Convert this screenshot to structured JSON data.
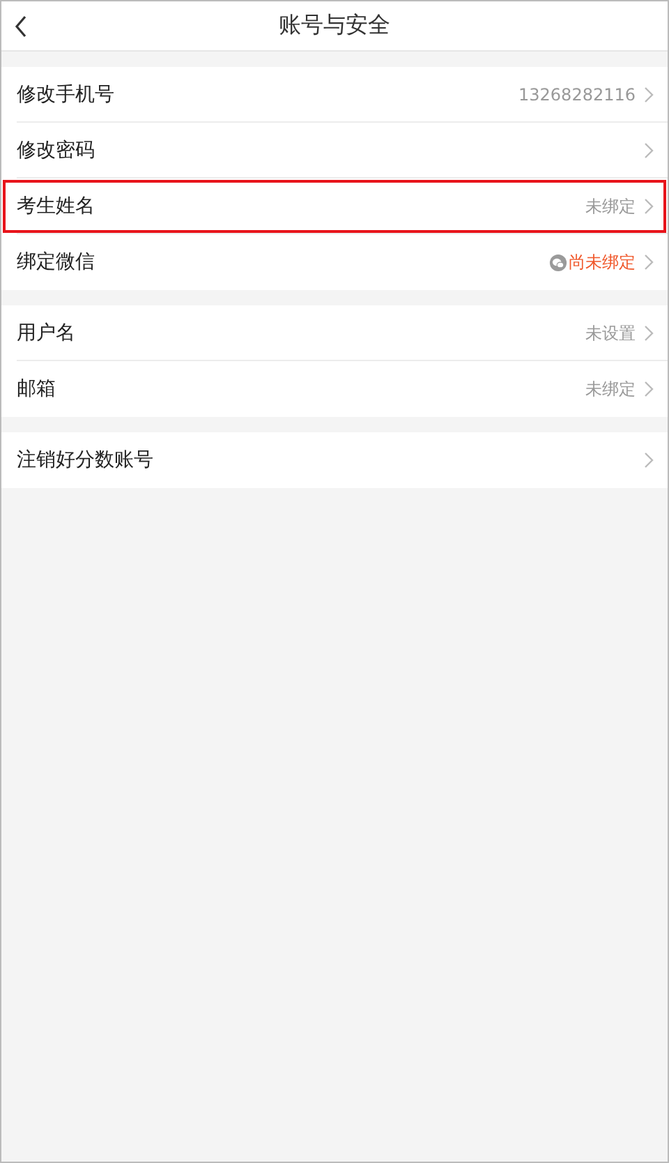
{
  "header": {
    "title": "账号与安全"
  },
  "groups": [
    {
      "rows": [
        {
          "label": "修改手机号",
          "value": "13268282116",
          "kind": "plain",
          "highlighted": false
        },
        {
          "label": "修改密码",
          "kind": "plain",
          "highlighted": false
        },
        {
          "label": "考生姓名",
          "value": "未绑定",
          "kind": "plain",
          "highlighted": true
        },
        {
          "label": "绑定微信",
          "value": "尚未绑定",
          "kind": "wechat",
          "highlighted": false
        }
      ]
    },
    {
      "rows": [
        {
          "label": "用户名",
          "value": "未设置",
          "kind": "plain",
          "highlighted": false
        },
        {
          "label": "邮箱",
          "value": "未绑定",
          "kind": "plain",
          "highlighted": false
        }
      ]
    },
    {
      "rows": [
        {
          "label": "注销好分数账号",
          "kind": "plain",
          "highlighted": false
        }
      ]
    }
  ]
}
